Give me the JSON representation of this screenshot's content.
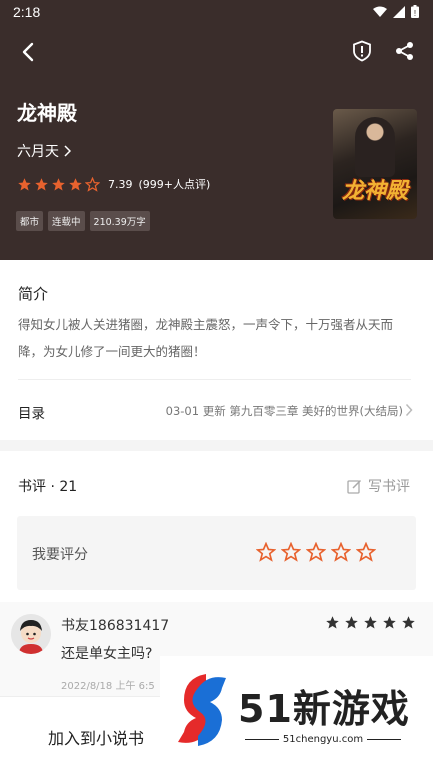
{
  "status_bar": {
    "time": "2:18"
  },
  "book": {
    "title": "龙神殿",
    "author": "六月天",
    "rating_score": "7.39",
    "rating_count": "(999+人点评)",
    "rating_stars_filled": 4.5,
    "tags": [
      "都市",
      "连载中",
      "210.39万字"
    ],
    "cover_text": "龙神殿"
  },
  "intro": {
    "title": "简介",
    "text": "得知女儿被人关进猪圈，龙神殿主震怒，一声令下，十万强者从天而降，为女儿修了一间更大的猪圈！"
  },
  "catalog": {
    "label": "目录",
    "latest": "03-01  更新  第九百零三章 美好的世界(大结局)"
  },
  "reviews": {
    "count_label": "书评 · 21",
    "write_label": "写书评",
    "rate_label": "我要评分",
    "rate_stars": 5,
    "items": [
      {
        "user": "书友186831417",
        "stars": 5,
        "text": "还是单女主吗?",
        "date": "2022/8/18 上午 6:5"
      }
    ]
  },
  "bottom": {
    "add_shelf": "加入到小说书"
  },
  "watermark": {
    "text": "51新游戏",
    "url": "51chengyu.com"
  },
  "colors": {
    "header_bg": "#3a2d2b",
    "star": "#e8622e",
    "tag_bg": "#5a4d4b"
  },
  "icons": [
    "back-arrow-icon",
    "shield-report-icon",
    "share-icon",
    "chevron-right-icon",
    "edit-icon",
    "star-icon",
    "wifi-icon",
    "signal-icon",
    "battery-icon"
  ]
}
